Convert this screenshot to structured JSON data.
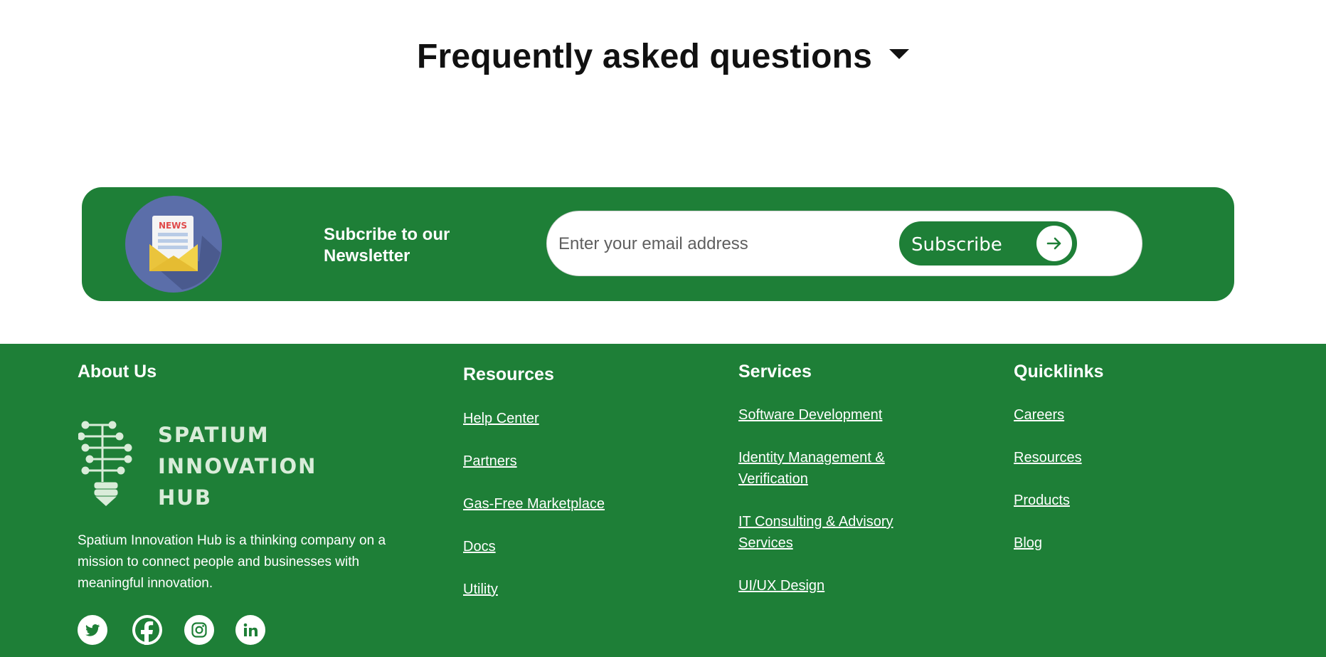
{
  "faq": {
    "title": "Frequently asked questions"
  },
  "newsletter": {
    "icon_badge": "NEWS",
    "label": "Subcribe to our Newsletter",
    "email_placeholder": "Enter your email address",
    "button_label": "Subscribe"
  },
  "footer": {
    "about": {
      "heading": "About Us",
      "logo_lines": [
        "SPATIUM",
        "INNOVATION",
        "HUB"
      ],
      "description": "Spatium Innovation Hub is a thinking company on a mission to connect people and businesses with meaningful innovation."
    },
    "resources": {
      "heading": "Resources",
      "links": [
        "Help Center",
        "Partners",
        "Gas-Free Marketplace",
        "Docs",
        "Utility"
      ]
    },
    "services": {
      "heading": "Services",
      "links": [
        "Software Development",
        "Identity Management & Verification",
        "IT Consulting & Advisory Services",
        "UI/UX Design"
      ]
    },
    "quicklinks": {
      "heading": "Quicklinks",
      "links": [
        "Careers",
        "Resources",
        "Products",
        "Blog"
      ]
    },
    "social_icons": [
      "twitter-icon",
      "facebook-icon",
      "instagram-icon",
      "linkedin-icon"
    ]
  },
  "colors": {
    "brand_green": "#1e7f37",
    "white": "#ffffff",
    "heading_text": "#111111"
  }
}
